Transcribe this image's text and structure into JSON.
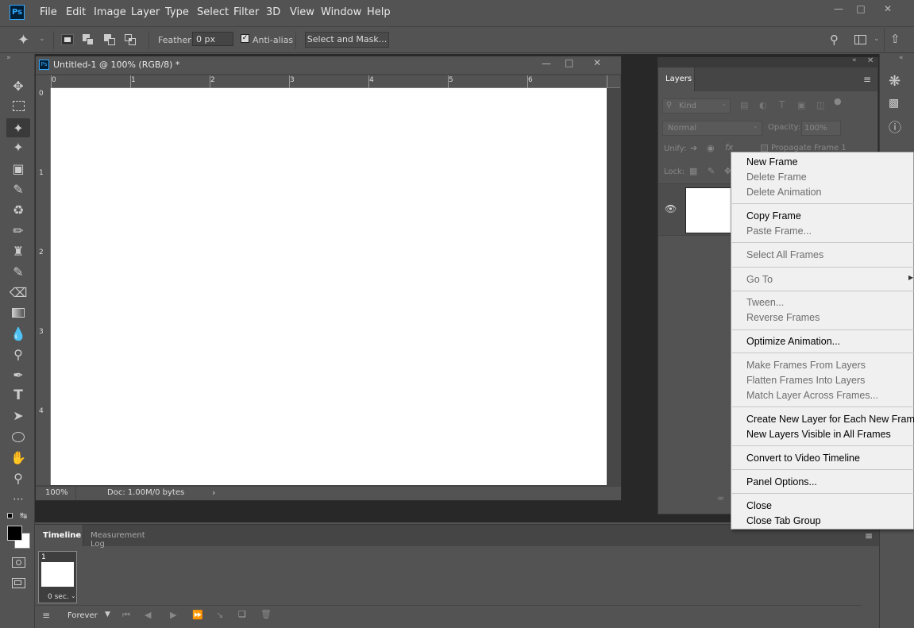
{
  "menubar": {
    "logo": "Ps",
    "items": [
      "File",
      "Edit",
      "Image",
      "Layer",
      "Type",
      "Select",
      "Filter",
      "3D",
      "View",
      "Window",
      "Help"
    ]
  },
  "options": {
    "feather_label": "Feather:",
    "feather_value": "0 px",
    "antialias_label": "Anti-alias",
    "antialias_checked": true,
    "select_mask_label": "Select and Mask..."
  },
  "document": {
    "tab_title": "Untitled-1 @ 100% (RGB/8) *",
    "ruler_h": [
      "0",
      "1",
      "2",
      "3",
      "4",
      "5",
      "6"
    ],
    "ruler_v": [
      "0",
      "1",
      "2",
      "3",
      "4"
    ],
    "zoom": "100%",
    "doc_info": "Doc: 1.00M/0 bytes"
  },
  "layers_panel": {
    "tab": "Layers",
    "kind_label": "Kind",
    "blend_mode": "Normal",
    "opacity_label": "Opacity:",
    "opacity_value": "100%",
    "unify_label": "Unify:",
    "propagate_label": "Propagate Frame 1",
    "lock_label": "Lock:"
  },
  "timeline": {
    "tabs": [
      "Timeline",
      "Measurement Log"
    ],
    "frame_number": "1",
    "frame_delay": "0 sec.",
    "loop": "Forever"
  },
  "context_menu": {
    "groups": [
      [
        {
          "label": "New Frame",
          "enabled": true
        },
        {
          "label": "Delete Frame",
          "enabled": false
        },
        {
          "label": "Delete Animation",
          "enabled": false
        }
      ],
      [
        {
          "label": "Copy Frame",
          "enabled": true
        },
        {
          "label": "Paste Frame...",
          "enabled": false
        }
      ],
      [
        {
          "label": "Select All Frames",
          "enabled": false
        }
      ],
      [
        {
          "label": "Go To",
          "enabled": false,
          "submenu": true
        }
      ],
      [
        {
          "label": "Tween...",
          "enabled": false
        },
        {
          "label": "Reverse Frames",
          "enabled": false
        }
      ],
      [
        {
          "label": "Optimize Animation...",
          "enabled": true
        }
      ],
      [
        {
          "label": "Make Frames From Layers",
          "enabled": false
        },
        {
          "label": "Flatten Frames Into Layers",
          "enabled": false
        },
        {
          "label": "Match Layer Across Frames...",
          "enabled": false
        }
      ],
      [
        {
          "label": "Create New Layer for Each New Frame",
          "enabled": true
        },
        {
          "label": "New Layers Visible in All Frames",
          "enabled": true
        }
      ],
      [
        {
          "label": "Convert to Video Timeline",
          "enabled": true
        }
      ],
      [
        {
          "label": "Panel Options...",
          "enabled": true
        }
      ],
      [
        {
          "label": "Close",
          "enabled": true
        },
        {
          "label": "Close Tab Group",
          "enabled": true
        }
      ]
    ]
  },
  "colors": {
    "background": "#535353",
    "workspace": "#282828",
    "menu_bg": "#f0f0f0",
    "accent": "#31a8ff"
  }
}
